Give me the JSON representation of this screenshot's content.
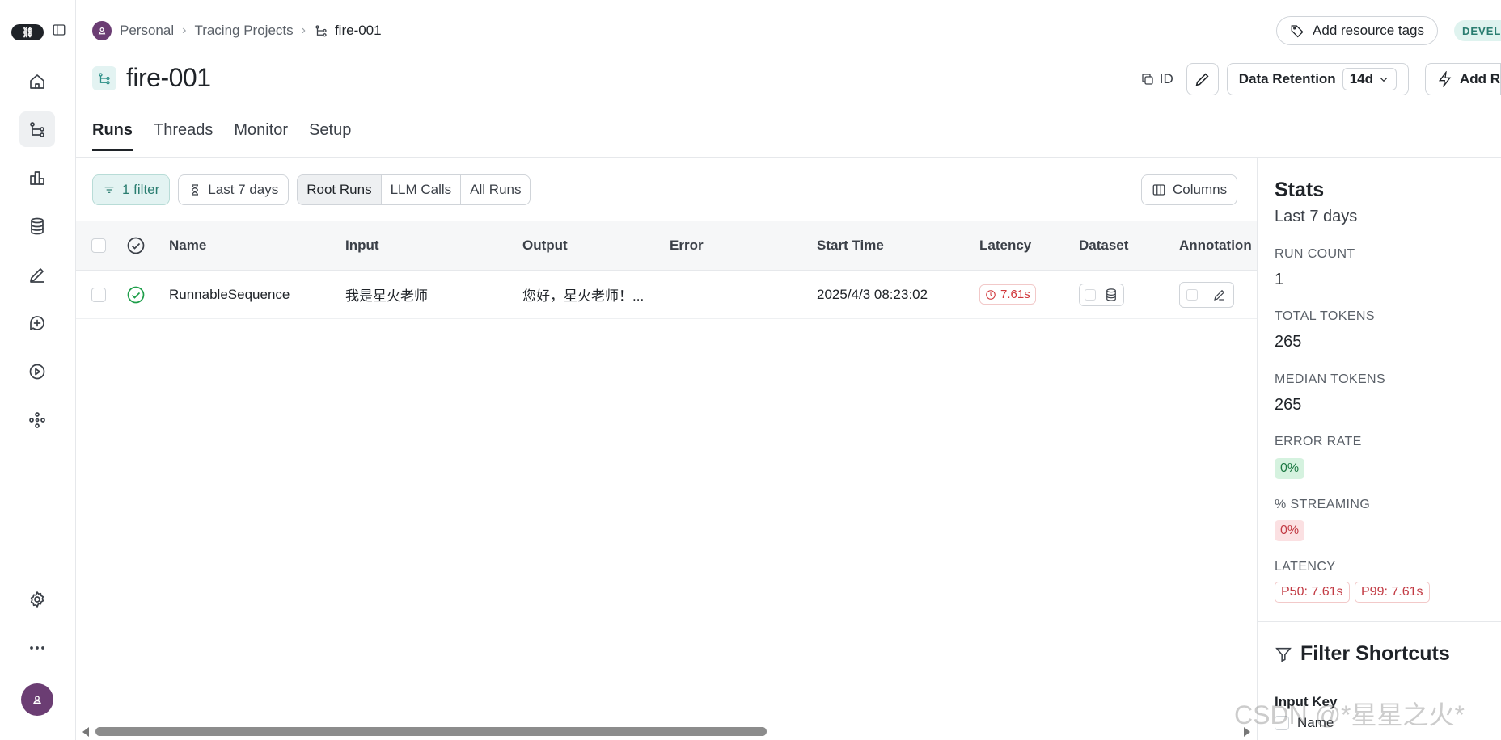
{
  "breadcrumb": {
    "workspace": "Personal",
    "section": "Tracing Projects",
    "current": "fire-001"
  },
  "header": {
    "add_tags_label": "Add resource tags",
    "env_badge": "DEVELOPMENT",
    "title": "fire-001",
    "id_label": "ID",
    "retention_label": "Data Retention",
    "retention_value": "14d",
    "add_rule_label": "Add Rule"
  },
  "tabs": [
    {
      "label": "Runs",
      "active": true
    },
    {
      "label": "Threads",
      "active": false
    },
    {
      "label": "Monitor",
      "active": false
    },
    {
      "label": "Setup",
      "active": false
    }
  ],
  "toolbar": {
    "filter_label": "1 filter",
    "time_label": "Last 7 days",
    "segments": [
      {
        "label": "Root Runs",
        "active": true
      },
      {
        "label": "LLM Calls",
        "active": false
      },
      {
        "label": "All Runs",
        "active": false
      }
    ],
    "columns_label": "Columns"
  },
  "table": {
    "columns": [
      "Name",
      "Input",
      "Output",
      "Error",
      "Start Time",
      "Latency",
      "Dataset",
      "Annotation"
    ],
    "rows": [
      {
        "status": "success",
        "name": "RunnableSequence",
        "input": "我是星火老师",
        "output": "您好，星火老师！...",
        "error": "",
        "start_time": "2025/4/3 08:23:02",
        "latency": "7.61s"
      }
    ]
  },
  "stats": {
    "title": "Stats",
    "period": "Last 7 days",
    "run_count_label": "RUN COUNT",
    "run_count": "1",
    "total_tokens_label": "TOTAL TOKENS",
    "total_tokens": "265",
    "median_tokens_label": "MEDIAN TOKENS",
    "median_tokens": "265",
    "error_rate_label": "ERROR RATE",
    "error_rate": "0%",
    "streaming_label": "% STREAMING",
    "streaming": "0%",
    "latency_label": "LATENCY",
    "p50": "P50: 7.61s",
    "p99": "P99: 7.61s"
  },
  "filter_shortcuts": {
    "title": "Filter Shortcuts",
    "input_key_label": "Input Key",
    "name_option": "Name"
  },
  "watermark": "CSDN @*星星之火*",
  "colors": {
    "accent_teal": "#2a7d70",
    "error_red": "#d0363a",
    "success_green": "#1e9e4a",
    "avatar_purple": "#6b3d73"
  }
}
